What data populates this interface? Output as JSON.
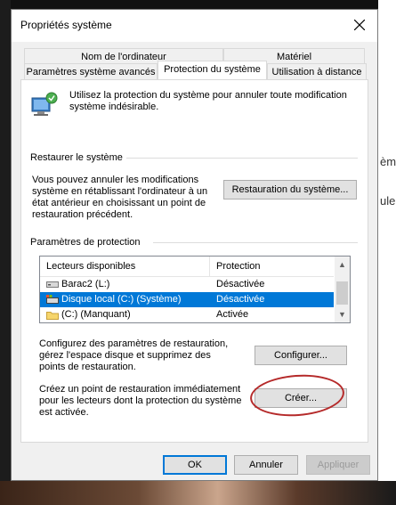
{
  "window": {
    "title": "Propriétés système"
  },
  "tabs": {
    "row1": [
      "Nom de l'ordinateur",
      "Matériel"
    ],
    "row2": [
      "Paramètres système avancés",
      "Protection du système",
      "Utilisation à distance"
    ],
    "active": "Protection du système"
  },
  "intro": {
    "text": "Utilisez la protection du système pour annuler toute modification système indésirable."
  },
  "restore": {
    "group_label": "Restaurer le système",
    "description": "Vous pouvez annuler les modifications système en rétablissant l'ordinateur à un état antérieur en choisissant un point de restauration précédent.",
    "button": "Restauration du système..."
  },
  "protection": {
    "group_label": "Paramètres de protection",
    "columns": [
      "Lecteurs disponibles",
      "Protection"
    ],
    "drives": [
      {
        "name": "Barac2 (L:)",
        "status": "Désactivée",
        "icon": "drive-icon"
      },
      {
        "name": "Disque local (C:) (Système)",
        "status": "Désactivée",
        "icon": "system-drive-icon",
        "selected": true
      },
      {
        "name": "(C:) (Manquant)",
        "status": "Activée",
        "icon": "folder-drive-icon"
      }
    ],
    "configure_text": "Configurez des paramètres de restauration, gérez l'espace disque et supprimez des points de restauration.",
    "configure_button": "Configurer...",
    "create_text": "Créez un point de restauration immédiatement pour les lecteurs dont la protection du système est activée.",
    "create_button": "Créer..."
  },
  "footer": {
    "ok": "OK",
    "cancel": "Annuler",
    "apply": "Appliquer"
  },
  "background": {
    "frag1": "èm",
    "frag2": "ule"
  },
  "colors": {
    "accent": "#0078d7",
    "annotation": "#b52a2a"
  }
}
